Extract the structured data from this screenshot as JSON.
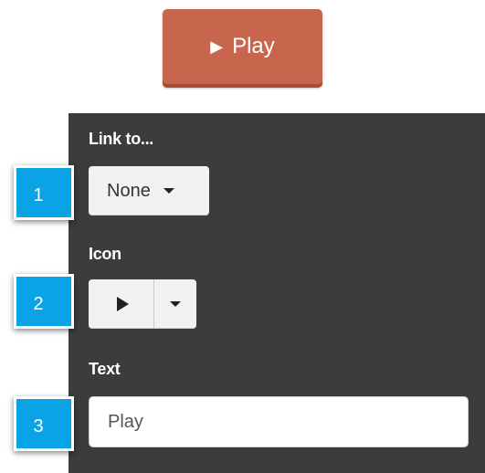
{
  "preview_button": {
    "icon": "play-icon",
    "label": "Play",
    "color": "#c8654d"
  },
  "panel": {
    "background": "#3c3c3c",
    "link_to": {
      "label": "Link to...",
      "selected": "None"
    },
    "icon": {
      "label": "Icon",
      "selected_icon": "play-icon"
    },
    "text": {
      "label": "Text",
      "value": "Play"
    }
  },
  "callouts": [
    "1",
    "2",
    "3"
  ],
  "callout_color": "#0aa3e6"
}
